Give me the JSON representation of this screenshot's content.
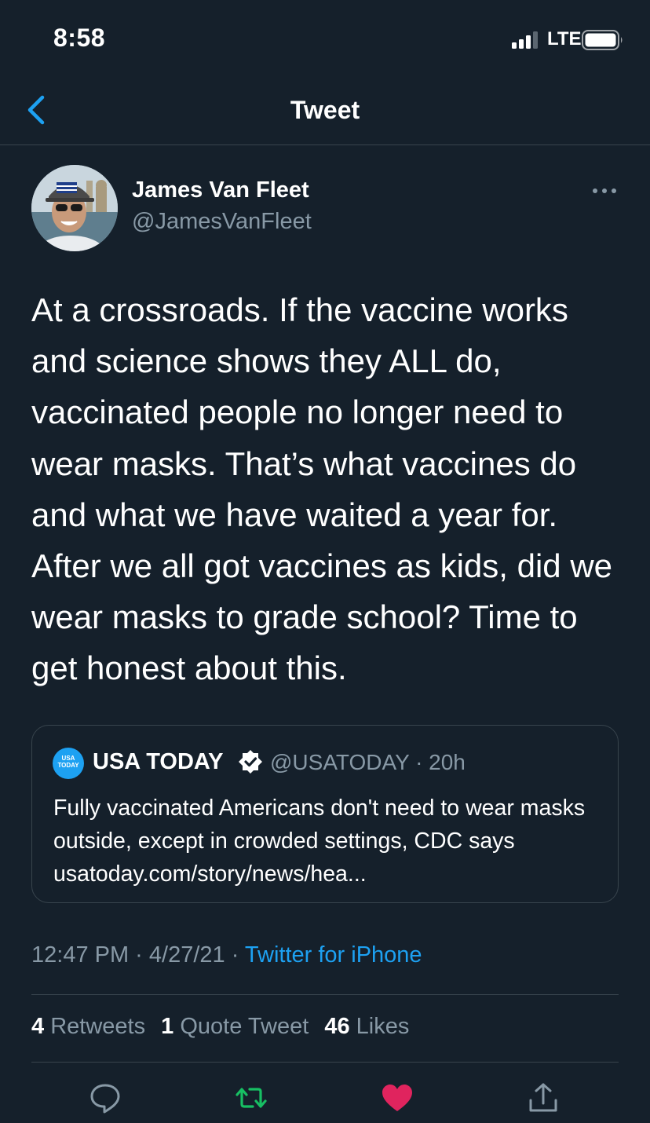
{
  "status_bar": {
    "time": "8:58",
    "network": "LTE"
  },
  "header": {
    "title": "Tweet",
    "back_icon": "chevron-left-icon"
  },
  "tweet": {
    "author": {
      "name": "James Van Fleet",
      "handle": "@JamesVanFleet"
    },
    "text": "At a crossroads. If the vaccine works and science shows they ALL do, vaccinated people no longer need to wear masks. That’s what vaccines do and what we have waited a year for. After we all got vaccines as kids, did we wear masks to grade school? Time to get honest about this.",
    "quoted": {
      "logo_text": "USA TODAY",
      "name": "USA TODAY",
      "handle_time": "@USATODAY · 20h",
      "text": "Fully vaccinated Americans don't need to wear masks outside, except in crowded settings, CDC says usatoday.com/story/news/hea..."
    },
    "time": "12:47 PM · 4/27/21 · ",
    "source": "Twitter for iPhone",
    "stats": {
      "retweets_count": "4",
      "retweets_label": "Retweets",
      "quotes_count": "1",
      "quotes_label": "Quote Tweet",
      "likes_count": "46",
      "likes_label": "Likes"
    }
  },
  "colors": {
    "background": "#15202b",
    "accent": "#1da1f2",
    "secondary_text": "#8899a6",
    "retweet_green": "#17bf63",
    "like_red": "#e0245e",
    "divider": "#38444d"
  },
  "actions": [
    "reply-icon",
    "retweet-icon",
    "like-icon",
    "share-icon"
  ]
}
